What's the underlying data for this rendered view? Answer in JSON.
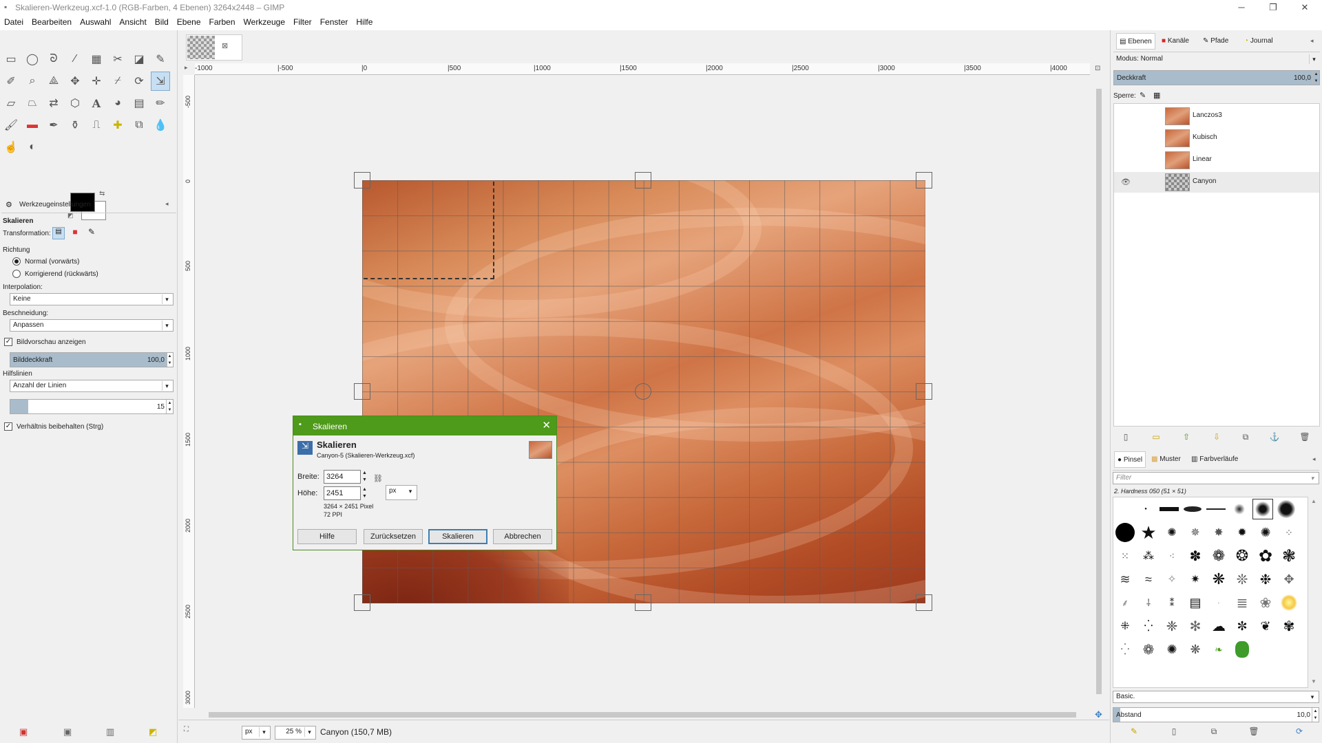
{
  "window": {
    "title": "Skalieren-Werkzeug.xcf-1.0 (RGB-Farben, 4 Ebenen) 3264x2448 – GIMP",
    "minimize": "─",
    "maximize": "❐",
    "close": "✕"
  },
  "menu": [
    "Datei",
    "Bearbeiten",
    "Auswahl",
    "Ansicht",
    "Bild",
    "Ebene",
    "Farben",
    "Werkzeuge",
    "Filter",
    "Fenster",
    "Hilfe"
  ],
  "tool_options": {
    "tab_label": "Werkzeugeinstellungen",
    "tool_name": "Skalieren",
    "transformation_label": "Transformation:",
    "direction_label": "Richtung",
    "direction_normal": "Normal (vorwärts)",
    "direction_corrective": "Korrigierend (rückwärts)",
    "interpolation_label": "Interpolation:",
    "interpolation_value": "Keine",
    "clipping_label": "Beschneidung:",
    "clipping_value": "Anpassen",
    "show_preview": "Bildvorschau anzeigen",
    "image_opacity_label": "Bilddeckkraft",
    "image_opacity_value": "100,0",
    "guides_label": "Hilfslinien",
    "guides_value": "Anzahl der Linien",
    "lines_value": "15",
    "keep_aspect": "Verhältnis beibehalten (Strg)"
  },
  "rulers": {
    "h_ticks": [
      "-1000",
      "|-500",
      "|0",
      "|500",
      "|1000",
      "|1500",
      "|2000",
      "|2500",
      "|3000",
      "|3500",
      "|4000"
    ],
    "v_ticks": [
      "-500",
      "0",
      "500",
      "1000",
      "1500",
      "2000",
      "2500",
      "3000"
    ]
  },
  "status": {
    "unit": "px",
    "zoom": "25 %",
    "info": "Canyon (150,7 MB)"
  },
  "dialog": {
    "title": "Skalieren",
    "heading": "Skalieren",
    "subheading": "Canyon-5 (Skalieren-Werkzeug.xcf)",
    "width_label": "Breite:",
    "width_value": "3264",
    "height_label": "Höhe:",
    "height_value": "2451",
    "unit": "px",
    "size_info": "3264 × 2451 Pixel",
    "resolution_info": "72 PPI",
    "help_button": "Hilfe",
    "reset_button": "Zurücksetzen",
    "scale_button": "Skalieren",
    "cancel_button": "Abbrechen"
  },
  "layers_panel": {
    "tabs": [
      "Ebenen",
      "Kanäle",
      "Pfade",
      "Journal"
    ],
    "mode_label": "Modus: Normal",
    "opacity_label": "Deckkraft",
    "opacity_value": "100,0",
    "lock_label": "Sperre:",
    "layers": [
      "Lanczos3",
      "Kubisch",
      "Linear",
      "Canyon"
    ]
  },
  "brushes_panel": {
    "tabs": [
      "Pinsel",
      "Muster",
      "Farbverläufe"
    ],
    "filter_placeholder": "Filter",
    "selected_brush": "2. Hardness 050 (51 × 51)",
    "preset": "Basic.",
    "spacing_label": "Abstand",
    "spacing_value": "10,0"
  },
  "colors": {
    "dialog_title_bg": "#4e9a1a",
    "foreground": "#000000",
    "background": "#ffffff"
  }
}
